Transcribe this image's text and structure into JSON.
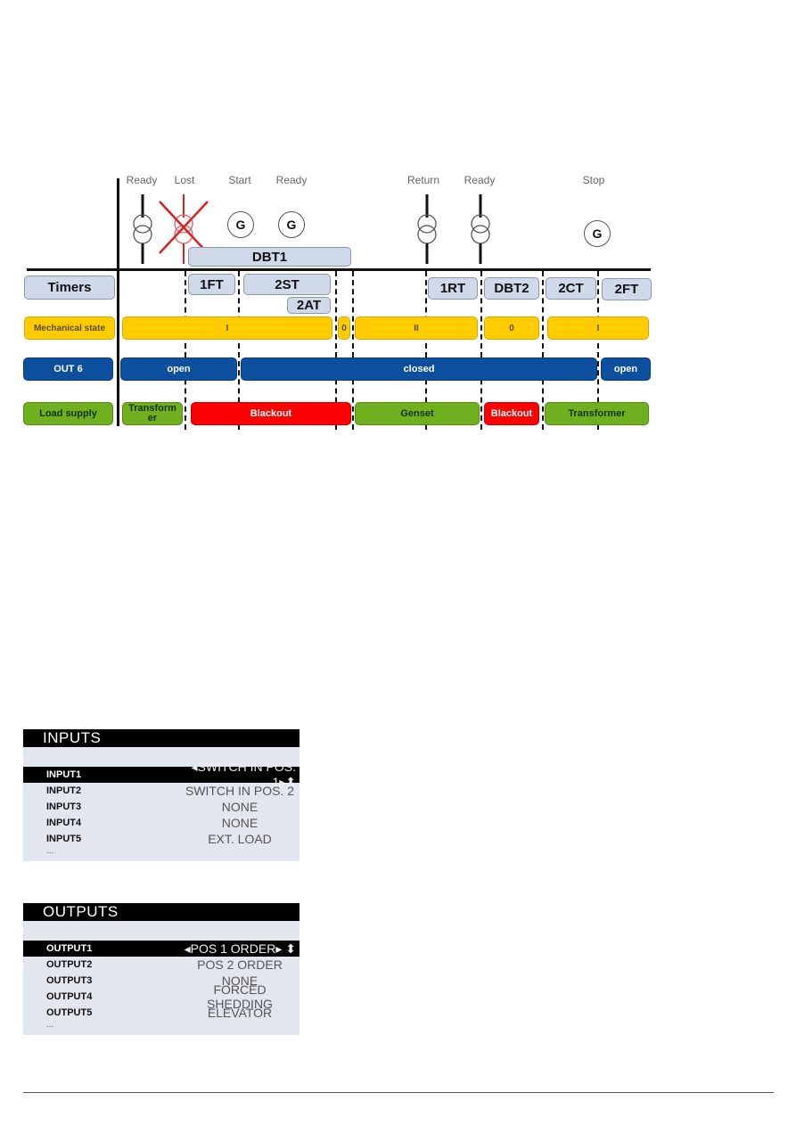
{
  "diagram": {
    "status_labels": [
      "Ready",
      "Lost",
      "Start",
      "Ready",
      "Return",
      "Ready",
      "Stop"
    ],
    "dbt1": "DBT1",
    "rows": {
      "timers": "Timers",
      "mechanical": "Mechanical state",
      "out6": "OUT 6",
      "load": "Load supply"
    },
    "timers": [
      "1FT",
      "2ST",
      "2AT",
      "1RT",
      "DBT2",
      "2CT",
      "2FT"
    ],
    "mechanical_states": [
      "I",
      "0",
      "II",
      "0",
      "I"
    ],
    "out6_states": [
      "open",
      "closed",
      "open"
    ],
    "load_states": [
      "Transform er",
      "Blackout",
      "Genset",
      "Blackout",
      "Transformer"
    ],
    "generator_symbol": "G",
    "colors": {
      "timer": "#cfd9ea",
      "mechanical": "#ffcc00",
      "out6": "#0b4f9e",
      "load": "#6fb01e",
      "blackout": "#ff0000"
    }
  },
  "inputs_panel": {
    "title": "INPUTS",
    "rows": [
      {
        "name": "INPUT1",
        "value": "SWITCH IN POS. 1"
      },
      {
        "name": "INPUT2",
        "value": "SWITCH IN POS. 2"
      },
      {
        "name": "INPUT3",
        "value": "NONE"
      },
      {
        "name": "INPUT4",
        "value": "NONE"
      },
      {
        "name": "INPUT5",
        "value": "EXT. LOAD"
      }
    ],
    "more": "..."
  },
  "outputs_panel": {
    "title": "OUTPUTS",
    "rows": [
      {
        "name": "OUTPUT1",
        "value": "POS 1 ORDER"
      },
      {
        "name": "OUTPUT2",
        "value": "POS 2 ORDER"
      },
      {
        "name": "OUTPUT3",
        "value": "NONE"
      },
      {
        "name": "OUTPUT4",
        "value": "FORCED SHEDDING"
      },
      {
        "name": "OUTPUT5",
        "value": "ELEVATOR"
      }
    ],
    "more": "..."
  }
}
